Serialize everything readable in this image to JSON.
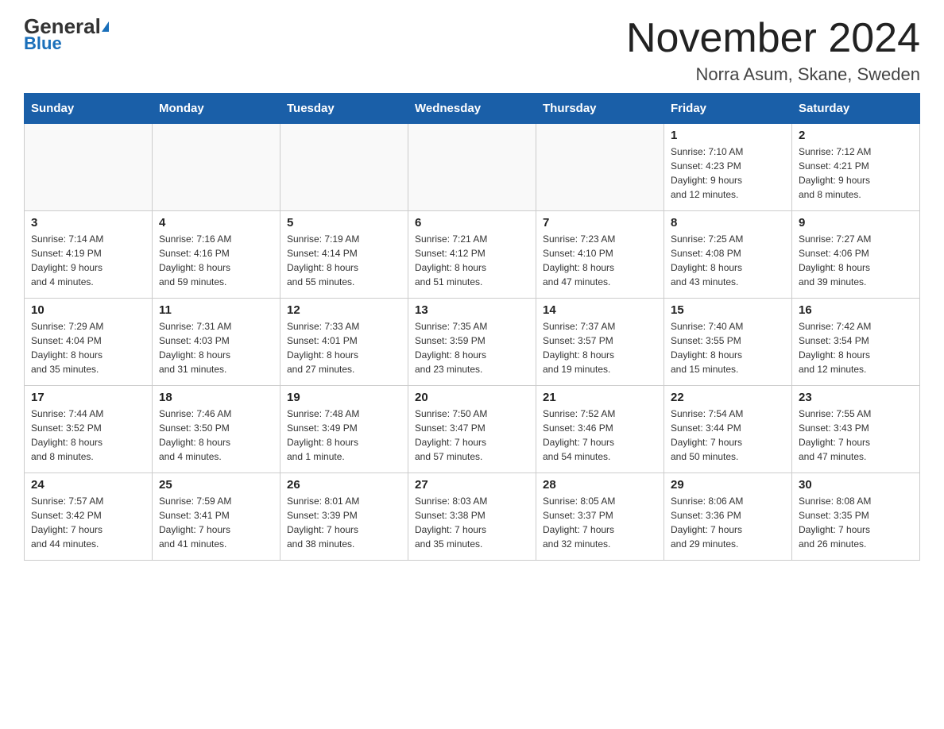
{
  "header": {
    "logo_general": "General",
    "logo_blue": "Blue",
    "month_title": "November 2024",
    "location": "Norra Asum, Skane, Sweden"
  },
  "days_of_week": [
    "Sunday",
    "Monday",
    "Tuesday",
    "Wednesday",
    "Thursday",
    "Friday",
    "Saturday"
  ],
  "weeks": [
    [
      {
        "day": "",
        "info": ""
      },
      {
        "day": "",
        "info": ""
      },
      {
        "day": "",
        "info": ""
      },
      {
        "day": "",
        "info": ""
      },
      {
        "day": "",
        "info": ""
      },
      {
        "day": "1",
        "info": "Sunrise: 7:10 AM\nSunset: 4:23 PM\nDaylight: 9 hours\nand 12 minutes."
      },
      {
        "day": "2",
        "info": "Sunrise: 7:12 AM\nSunset: 4:21 PM\nDaylight: 9 hours\nand 8 minutes."
      }
    ],
    [
      {
        "day": "3",
        "info": "Sunrise: 7:14 AM\nSunset: 4:19 PM\nDaylight: 9 hours\nand 4 minutes."
      },
      {
        "day": "4",
        "info": "Sunrise: 7:16 AM\nSunset: 4:16 PM\nDaylight: 8 hours\nand 59 minutes."
      },
      {
        "day": "5",
        "info": "Sunrise: 7:19 AM\nSunset: 4:14 PM\nDaylight: 8 hours\nand 55 minutes."
      },
      {
        "day": "6",
        "info": "Sunrise: 7:21 AM\nSunset: 4:12 PM\nDaylight: 8 hours\nand 51 minutes."
      },
      {
        "day": "7",
        "info": "Sunrise: 7:23 AM\nSunset: 4:10 PM\nDaylight: 8 hours\nand 47 minutes."
      },
      {
        "day": "8",
        "info": "Sunrise: 7:25 AM\nSunset: 4:08 PM\nDaylight: 8 hours\nand 43 minutes."
      },
      {
        "day": "9",
        "info": "Sunrise: 7:27 AM\nSunset: 4:06 PM\nDaylight: 8 hours\nand 39 minutes."
      }
    ],
    [
      {
        "day": "10",
        "info": "Sunrise: 7:29 AM\nSunset: 4:04 PM\nDaylight: 8 hours\nand 35 minutes."
      },
      {
        "day": "11",
        "info": "Sunrise: 7:31 AM\nSunset: 4:03 PM\nDaylight: 8 hours\nand 31 minutes."
      },
      {
        "day": "12",
        "info": "Sunrise: 7:33 AM\nSunset: 4:01 PM\nDaylight: 8 hours\nand 27 minutes."
      },
      {
        "day": "13",
        "info": "Sunrise: 7:35 AM\nSunset: 3:59 PM\nDaylight: 8 hours\nand 23 minutes."
      },
      {
        "day": "14",
        "info": "Sunrise: 7:37 AM\nSunset: 3:57 PM\nDaylight: 8 hours\nand 19 minutes."
      },
      {
        "day": "15",
        "info": "Sunrise: 7:40 AM\nSunset: 3:55 PM\nDaylight: 8 hours\nand 15 minutes."
      },
      {
        "day": "16",
        "info": "Sunrise: 7:42 AM\nSunset: 3:54 PM\nDaylight: 8 hours\nand 12 minutes."
      }
    ],
    [
      {
        "day": "17",
        "info": "Sunrise: 7:44 AM\nSunset: 3:52 PM\nDaylight: 8 hours\nand 8 minutes."
      },
      {
        "day": "18",
        "info": "Sunrise: 7:46 AM\nSunset: 3:50 PM\nDaylight: 8 hours\nand 4 minutes."
      },
      {
        "day": "19",
        "info": "Sunrise: 7:48 AM\nSunset: 3:49 PM\nDaylight: 8 hours\nand 1 minute."
      },
      {
        "day": "20",
        "info": "Sunrise: 7:50 AM\nSunset: 3:47 PM\nDaylight: 7 hours\nand 57 minutes."
      },
      {
        "day": "21",
        "info": "Sunrise: 7:52 AM\nSunset: 3:46 PM\nDaylight: 7 hours\nand 54 minutes."
      },
      {
        "day": "22",
        "info": "Sunrise: 7:54 AM\nSunset: 3:44 PM\nDaylight: 7 hours\nand 50 minutes."
      },
      {
        "day": "23",
        "info": "Sunrise: 7:55 AM\nSunset: 3:43 PM\nDaylight: 7 hours\nand 47 minutes."
      }
    ],
    [
      {
        "day": "24",
        "info": "Sunrise: 7:57 AM\nSunset: 3:42 PM\nDaylight: 7 hours\nand 44 minutes."
      },
      {
        "day": "25",
        "info": "Sunrise: 7:59 AM\nSunset: 3:41 PM\nDaylight: 7 hours\nand 41 minutes."
      },
      {
        "day": "26",
        "info": "Sunrise: 8:01 AM\nSunset: 3:39 PM\nDaylight: 7 hours\nand 38 minutes."
      },
      {
        "day": "27",
        "info": "Sunrise: 8:03 AM\nSunset: 3:38 PM\nDaylight: 7 hours\nand 35 minutes."
      },
      {
        "day": "28",
        "info": "Sunrise: 8:05 AM\nSunset: 3:37 PM\nDaylight: 7 hours\nand 32 minutes."
      },
      {
        "day": "29",
        "info": "Sunrise: 8:06 AM\nSunset: 3:36 PM\nDaylight: 7 hours\nand 29 minutes."
      },
      {
        "day": "30",
        "info": "Sunrise: 8:08 AM\nSunset: 3:35 PM\nDaylight: 7 hours\nand 26 minutes."
      }
    ]
  ]
}
